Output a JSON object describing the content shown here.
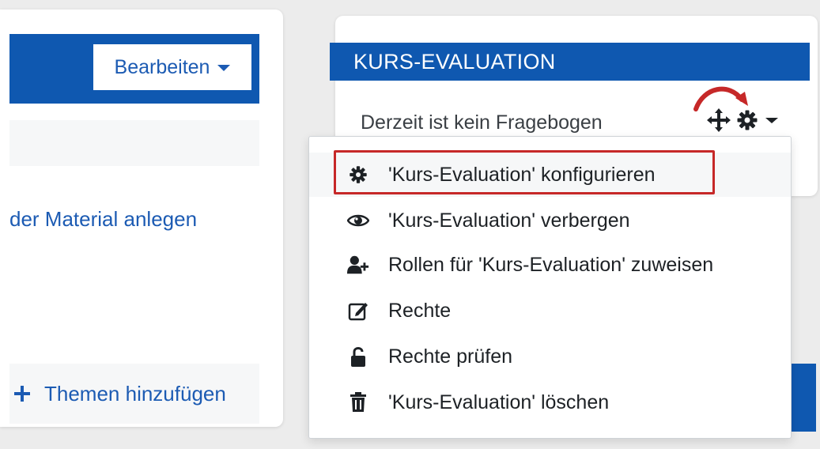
{
  "course": {
    "edit_button_label": "Bearbeiten",
    "activity_link": "der Material anlegen",
    "add_topics_label": "Themen hinzufügen"
  },
  "block": {
    "title": "KURS-EVALUATION",
    "body_text": "Derzeit ist kein Fragebogen"
  },
  "menu": {
    "items": [
      {
        "label": "'Kurs-Evaluation' konfigurieren",
        "icon": "gear-icon"
      },
      {
        "label": "'Kurs-Evaluation' verbergen",
        "icon": "eye-icon"
      },
      {
        "label": "Rollen für 'Kurs-Evaluation' zuweisen",
        "icon": "user-plus-icon"
      },
      {
        "label": "Rechte",
        "icon": "edit-icon"
      },
      {
        "label": "Rechte prüfen",
        "icon": "unlock-icon"
      },
      {
        "label": "'Kurs-Evaluation' löschen",
        "icon": "trash-icon"
      }
    ]
  },
  "colors": {
    "primary_blue": "#0f58b0",
    "link_blue": "#1c5bb3",
    "highlight_red": "#c62828",
    "background": "#ececec"
  }
}
